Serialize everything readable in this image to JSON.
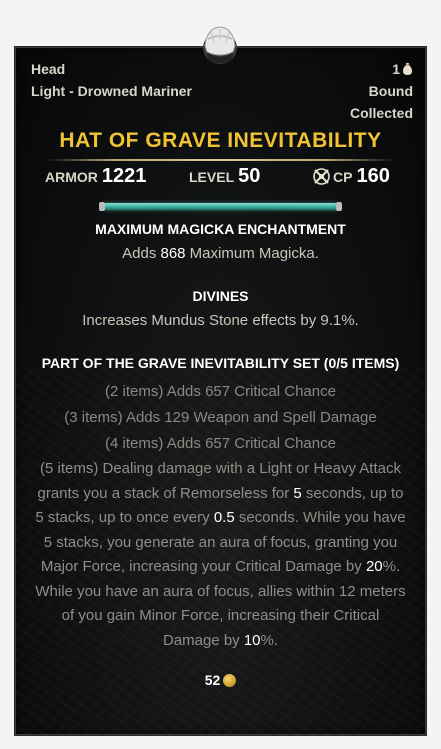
{
  "item": {
    "slot": "Head",
    "type": "Light - Drowned Mariner",
    "count": "1",
    "bound": "Bound",
    "collected": "Collected",
    "name": "HAT OF GRAVE INEVITABILITY"
  },
  "stats": {
    "armor_label": "ARMOR",
    "armor_value": "1221",
    "level_label": "LEVEL",
    "level_value": "50",
    "cp_label": "CP",
    "cp_value": "160"
  },
  "enchantment": {
    "heading": "MAXIMUM MAGICKA ENCHANTMENT",
    "desc_prefix": "Adds ",
    "desc_value": "868",
    "desc_suffix": " Maximum Magicka."
  },
  "trait": {
    "heading": "DIVINES",
    "desc": "Increases Mundus Stone effects by 9.1%."
  },
  "set": {
    "heading": "PART OF THE GRAVE INEVITABILITY SET (0/5 ITEMS)",
    "bonus2": "(2 items) Adds 657 Critical Chance",
    "bonus3": "(3 items) Adds 129 Weapon and Spell Damage",
    "bonus4": "(4 items) Adds 657 Critical Chance",
    "bonus5_parts": {
      "a": "(5 items) Dealing damage with a Light or Heavy Attack grants you a stack of Remorseless for ",
      "v1": "5",
      "b": " seconds, up to 5 stacks, up to once every ",
      "v2": "0.5",
      "c": " seconds. While you have 5 stacks, you generate an aura of focus, granting you Major Force, increasing your Critical Damage by ",
      "v3": "20",
      "d": "%. While you have an aura of focus, allies within 12 meters of you gain Minor Force, increasing their Critical Damage by ",
      "v4": "10",
      "e": "%."
    }
  },
  "value": {
    "gold": "52"
  },
  "icons": {
    "item": "hat-icon",
    "cp": "champion-point-icon",
    "coin": "gold-coin-icon",
    "stack": "item-bag-icon"
  },
  "colors": {
    "title": "#f1c232",
    "charge": "#3fb6a6",
    "text": "#d8d6c8",
    "inactive": "#8a8a82"
  }
}
